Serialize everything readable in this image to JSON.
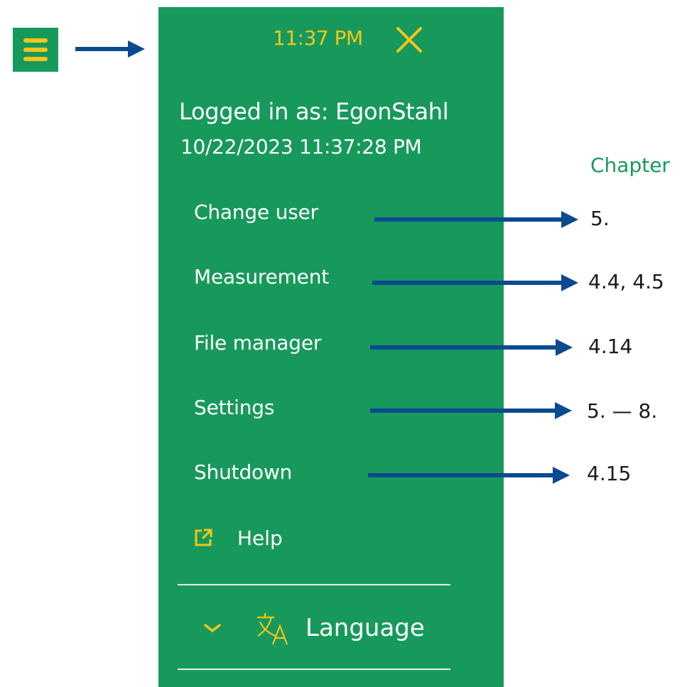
{
  "menu": {
    "clock": "11:37 PM",
    "logged_in": "Logged in as: EgonStahl",
    "timestamp": "10/22/2023 11:37:28 PM",
    "items": [
      {
        "label": "Change user",
        "chapter": "5."
      },
      {
        "label": "Measurement",
        "chapter": "4.4, 4.5"
      },
      {
        "label": "File manager",
        "chapter": "4.14"
      },
      {
        "label": "Settings",
        "chapter": "5. — 8."
      },
      {
        "label": "Shutdown",
        "chapter": "4.15"
      }
    ],
    "help_label": "Help",
    "language_label": "Language"
  },
  "annotation": {
    "chapter_title": "Chapter"
  },
  "icons": {
    "menu": "hamburger-icon",
    "close": "close-icon",
    "help": "external-link-icon",
    "expand": "chevron-down-icon",
    "language": "translate-icon"
  },
  "colors": {
    "panel": "#17995c",
    "accent": "#f5c518",
    "arrow": "#0b4a8f",
    "text": "#ffffff"
  }
}
